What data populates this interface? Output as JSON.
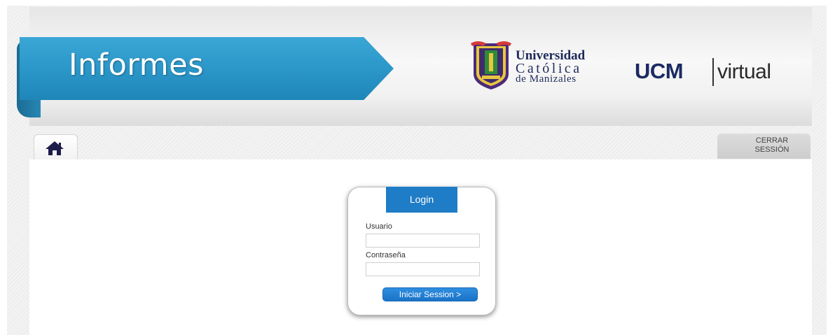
{
  "header": {
    "section_title": "Informes",
    "university": {
      "line1": "Universidad",
      "line2": "Católica",
      "line3": "de Manizales"
    },
    "brand": {
      "name": "UCM",
      "suffix": "virtual"
    },
    "colors": {
      "ribbon": "#2a95c7",
      "navy": "#1b2a63"
    }
  },
  "nav": {
    "home_icon": "home-icon",
    "logout_label": "CERRAR SESSIÓN"
  },
  "login": {
    "title": "Login",
    "username_label": "Usuario",
    "username_value": "",
    "password_label": "Contraseña",
    "password_value": "",
    "submit_label": "Iniciar Session >",
    "accent_color": "#1f7cc6"
  }
}
